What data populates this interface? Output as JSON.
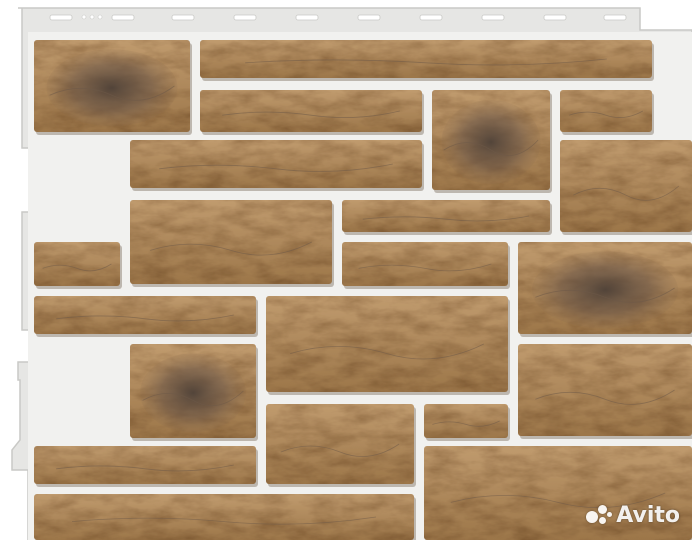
{
  "image": {
    "subject": "facade-stone-panel",
    "colors": {
      "background": "#ffffff",
      "frame": "#e6e6e4",
      "frame_shadow": "#c9c9c6",
      "stone_light": "#b89468",
      "stone_mid": "#a17a4d",
      "stone_dark": "#6e5a48",
      "stone_shadow": "#5c4a3a",
      "grout": "#f1f1ef"
    }
  },
  "watermark": {
    "text": "Avito",
    "icon": "avito-dots-icon"
  }
}
